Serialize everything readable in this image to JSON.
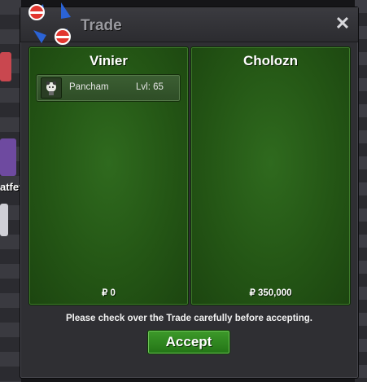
{
  "window": {
    "title": "Trade",
    "close_symbol": "✕"
  },
  "background": {
    "partial_name": "atfev"
  },
  "left_panel": {
    "player_name": "Vinier",
    "item": {
      "pokemon": "Pancham",
      "level": "Lvl: 65",
      "icon": "pancham-sprite-icon"
    },
    "money": "₽ 0"
  },
  "right_panel": {
    "player_name": "Cholozn",
    "money": "₽ 350,000"
  },
  "notice": "Please check over the Trade carefully before accepting.",
  "accept_label": "Accept",
  "colors": {
    "panel_green": "#245615",
    "accept_green": "#2f8a20",
    "window": "#2f2f33"
  }
}
